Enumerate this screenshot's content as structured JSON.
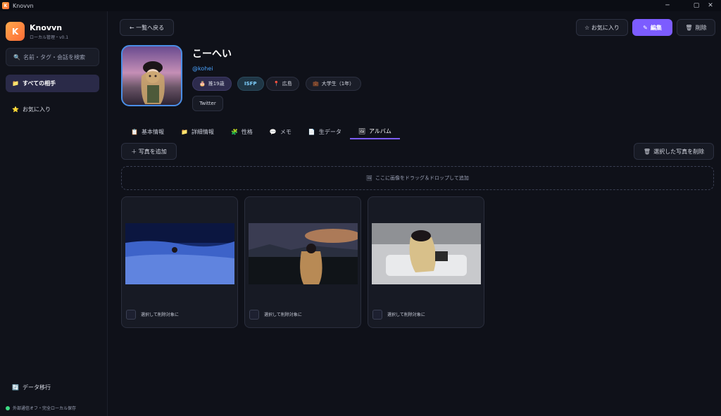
{
  "window": {
    "title": "Knovvn",
    "minimize": "─",
    "maximize": "▢",
    "close": "✕"
  },
  "sidebar": {
    "app_name": "Knovvn",
    "app_sub": "ローカル管理・v0.1",
    "logo_letter": "K",
    "search_placeholder": "名前・タグ・会話を検索",
    "items": [
      {
        "label": "すべての相手",
        "active": true
      },
      {
        "label": "お気に入り",
        "active": false
      }
    ],
    "footer": {
      "migrate_label": "データ移行",
      "status_label": "外部通信オフ・完全ローカル保存"
    }
  },
  "header": {
    "back_label": "← 一覧へ戻る",
    "favorite_label": "☆ お気に入り",
    "edit_label": "編集",
    "delete_label": "削除"
  },
  "profile": {
    "name": "こーへい",
    "handle": "@kohei",
    "tags": [
      "推19歳",
      "ISFP",
      "広島",
      "大学生（1年）"
    ],
    "links": [
      "Twitter"
    ]
  },
  "tabs": [
    {
      "label": "基本情報",
      "icon": "clipboard-icon",
      "active": false
    },
    {
      "label": "詳細情報",
      "icon": "folder-icon",
      "active": false
    },
    {
      "label": "性格",
      "icon": "puzzle-icon",
      "active": false
    },
    {
      "label": "メモ",
      "icon": "speech-bubble-icon",
      "active": false
    },
    {
      "label": "生データ",
      "icon": "document-icon",
      "active": false
    },
    {
      "label": "アルバム",
      "icon": "picture-icon",
      "active": true
    }
  ],
  "album": {
    "add_photo_label": "＋ 写真を追加",
    "delete_selected_label": "選択した写真を削除",
    "dropzone_label": "ここに画像をドラッグ＆ドロップして追加",
    "select_label": "選択して削除対象に",
    "photos": [
      {
        "scene": "blue-flower-field"
      },
      {
        "scene": "sunset-lake"
      },
      {
        "scene": "white-room"
      }
    ]
  },
  "colors": {
    "accent": "#7c5cff",
    "link": "#4aa3ff",
    "background": "#0f1119"
  }
}
